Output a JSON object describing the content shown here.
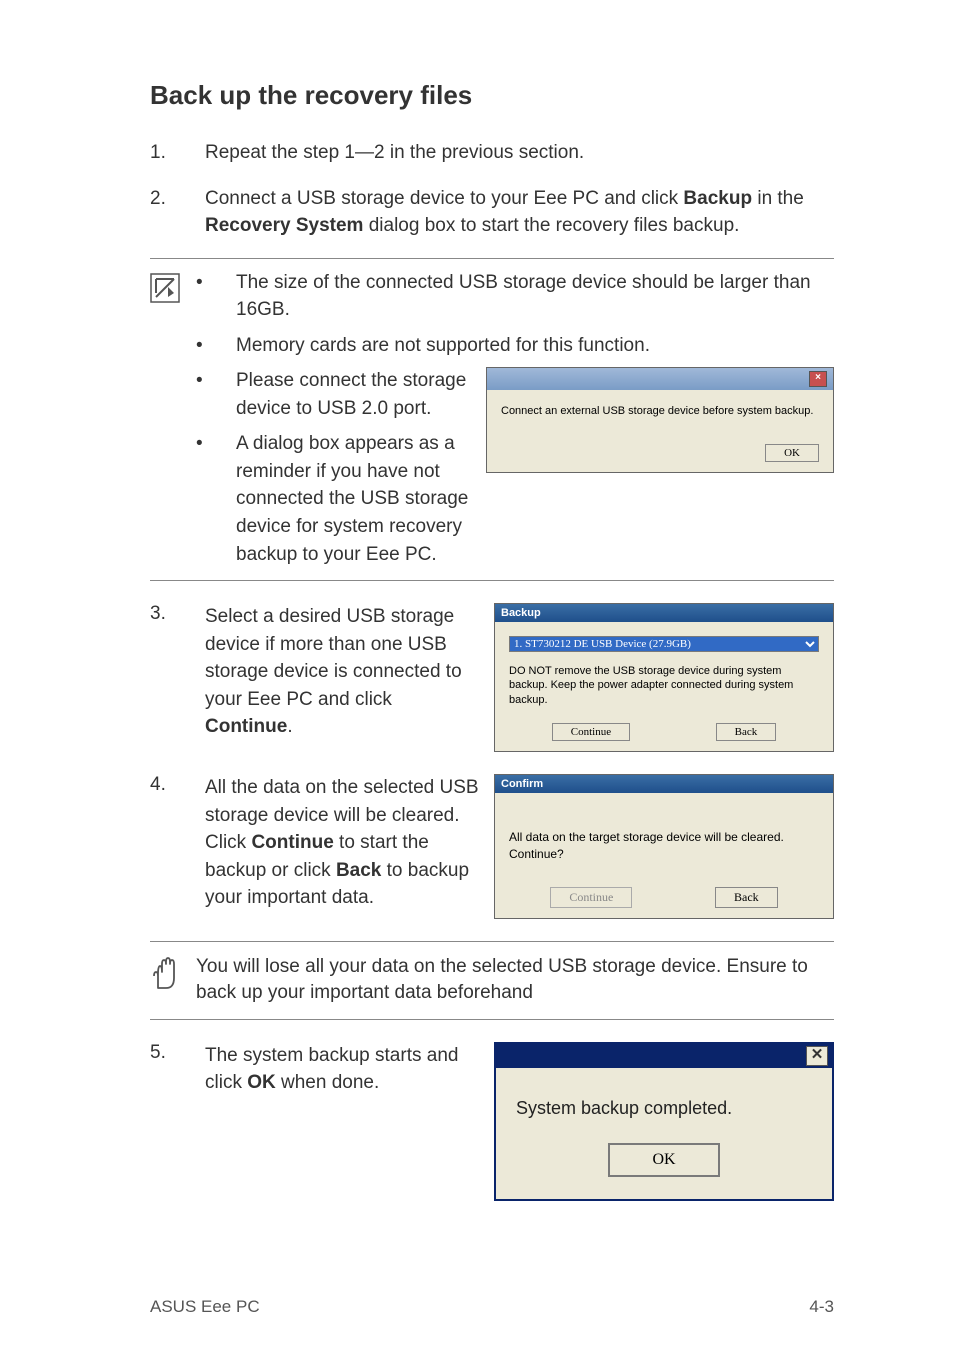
{
  "heading": "Back up the recovery files",
  "steps": {
    "s1": {
      "num": "1.",
      "text_a": "Repeat the step 1—2 in the previous section."
    },
    "s2": {
      "num": "2.",
      "text_a": "Connect a USB storage device to your Eee PC and click ",
      "bold_a": "Backup",
      "text_b": " in the ",
      "bold_b": "Recovery System",
      "text_c": " dialog box to start the recovery files backup."
    },
    "s3": {
      "num": "3.",
      "text_a": "Select a desired USB storage device if more than one USB storage device is connected to your Eee PC and click ",
      "bold_a": "Continue",
      "text_b": "."
    },
    "s4": {
      "num": "4.",
      "text_a": "All the data on the selected USB storage device will be cleared. Click ",
      "bold_a": "Continue",
      "text_b": " to start the backup or click ",
      "bold_b": "Back",
      "text_c": " to backup your important data."
    },
    "s5": {
      "num": "5.",
      "text_a": "The system backup starts and click ",
      "bold_a": "OK",
      "text_b": " when done."
    }
  },
  "notes": {
    "b1": "The size of the connected USB storage device should be larger than 16GB.",
    "b2": "Memory cards are not supported for this function.",
    "b3": "Please connect the storage device to USB 2.0 port.",
    "b4": "A dialog box appears as a reminder if you have not connected the USB storage device for system recovery backup to your Eee PC."
  },
  "warn": "You will lose all your data on the selected USB storage device. Ensure to back up your important data beforehand",
  "dlg1": {
    "msg": "Connect an external USB storage device before system backup.",
    "ok": "OK"
  },
  "dlg2": {
    "title": "Backup",
    "option": "1. ST730212 DE USB Device  (27.9GB)",
    "msg": "DO NOT remove the USB storage device during system backup. Keep the power adapter connected during system backup.",
    "continue": "Continue",
    "back": "Back"
  },
  "dlg3": {
    "title": "Confirm",
    "msg": "All data on the target storage device will be cleared. Continue?",
    "continue": "Continue",
    "back": "Back"
  },
  "dlg4": {
    "msg": "System backup completed.",
    "ok": "OK"
  },
  "footer": {
    "left": "ASUS Eee PC",
    "right": "4-3"
  },
  "bullet_dot": "•"
}
